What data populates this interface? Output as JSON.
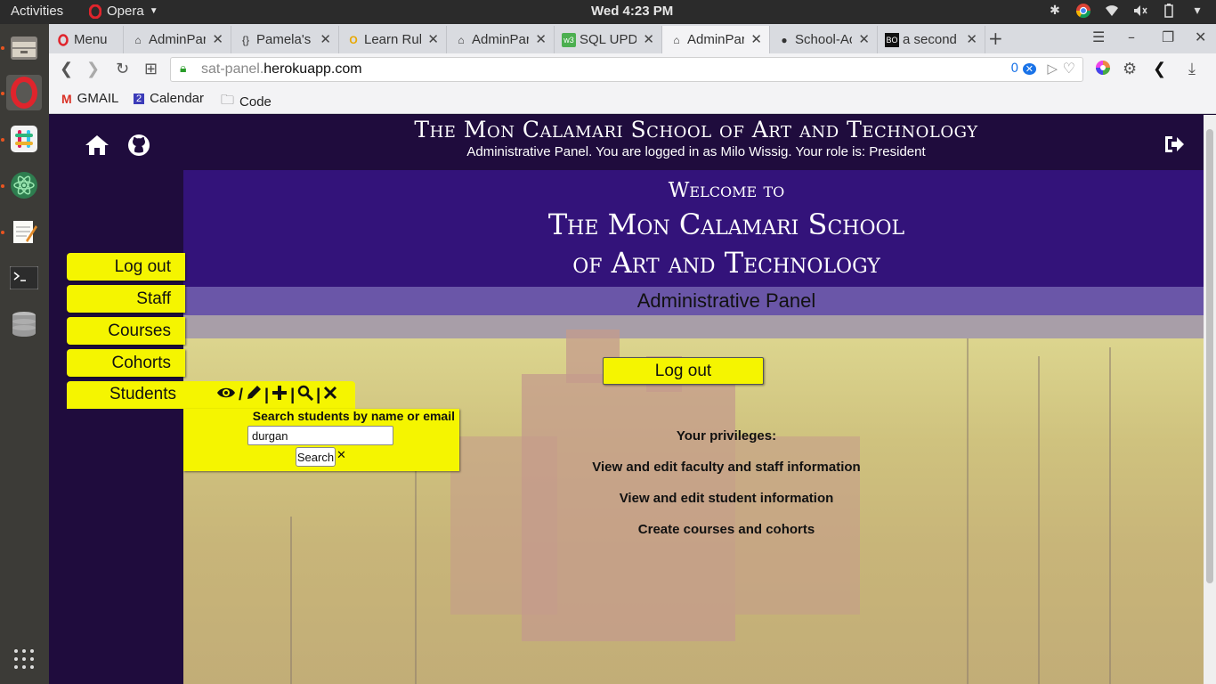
{
  "os": {
    "activities": "Activities",
    "app_name": "Opera",
    "clock": "Wed  4:23 PM"
  },
  "browser": {
    "tabs": [
      {
        "label": "Menu",
        "icon": "opera-icon"
      },
      {
        "label": "AdminPar",
        "icon": "home-icon"
      },
      {
        "label": "Pamela's",
        "icon": "braces-icon"
      },
      {
        "label": "Learn Rub",
        "icon": "ring-icon"
      },
      {
        "label": "AdminPar",
        "icon": "home-icon"
      },
      {
        "label": "SQL UPDA",
        "icon": "w3-icon"
      },
      {
        "label": "AdminPar",
        "icon": "home-icon"
      },
      {
        "label": "School-Ac",
        "icon": "github-icon"
      },
      {
        "label": "a second",
        "icon": "bo-icon"
      }
    ],
    "url_prefix": "sat-panel.",
    "url_domain": "herokuapp.com",
    "adblock_count": "0",
    "bookmarks": [
      {
        "label": "GMAIL",
        "icon": "gmail-icon"
      },
      {
        "label": "Calendar",
        "icon": "calendar-icon",
        "badge": "2"
      },
      {
        "label": "Code",
        "icon": "folder-icon"
      }
    ]
  },
  "page": {
    "header_title": "The Mon Calamari School of Art and Technology",
    "header_subtitle": "Administrative Panel. You are logged in as Milo Wissig. Your role is: President",
    "welcome_small": "Welcome to",
    "welcome_line1": "The Mon Calamari School",
    "welcome_line2": "of Art and Technology",
    "admin_panel": "Administrative Panel",
    "logout_main": "Log out",
    "privileges_title": "Your privileges:",
    "privileges": [
      "View and edit faculty and staff information",
      "View and edit student information",
      "Create courses and cohorts"
    ],
    "side_menu": [
      "Log out",
      "Staff",
      "Courses",
      "Cohorts",
      "Students"
    ],
    "search": {
      "label": "Search students by name or email",
      "value": "durgan",
      "button": "Search"
    }
  },
  "colors": {
    "accent_yellow": "#f5f500",
    "header_purple": "#1f0c3d",
    "welcome_purple": "#33137a",
    "admin_band": "#6a56a8"
  }
}
